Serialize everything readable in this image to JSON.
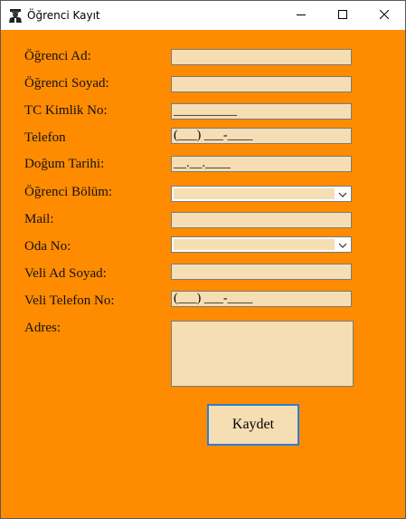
{
  "window": {
    "title": "Öğrenci Kayıt"
  },
  "labels": {
    "ad": "Öğrenci Ad:",
    "soyad": "Öğrenci Soyad:",
    "tc": "TC Kimlik No:",
    "telefon": "Telefon",
    "dogum": "Doğum Tarihi:",
    "bolum": "Öğrenci Bölüm:",
    "mail": "Mail:",
    "oda": "Oda No:",
    "veli_ad": "Veli Ad Soyad:",
    "veli_tel": "Veli Telefon No:",
    "adres": "Adres:"
  },
  "fields": {
    "ad": "",
    "soyad": "",
    "tc_mask": "__________",
    "telefon_mask": "(___) ___-____",
    "dogum_mask": "__.__.____",
    "bolum_selected": "",
    "mail": "",
    "oda_selected": "",
    "veli_ad": "",
    "veli_tel_mask": "(___) ___-____",
    "adres": ""
  },
  "buttons": {
    "save": "Kaydet"
  },
  "colors": {
    "form_background": "#ff8c00",
    "field_background": "#f5deb3",
    "button_focus_border": "#2a7fd4"
  },
  "icons": {
    "app": "student-icon",
    "minimize": "minimize-icon",
    "maximize": "maximize-icon",
    "close": "close-icon",
    "dropdown": "chevron-down-icon"
  }
}
